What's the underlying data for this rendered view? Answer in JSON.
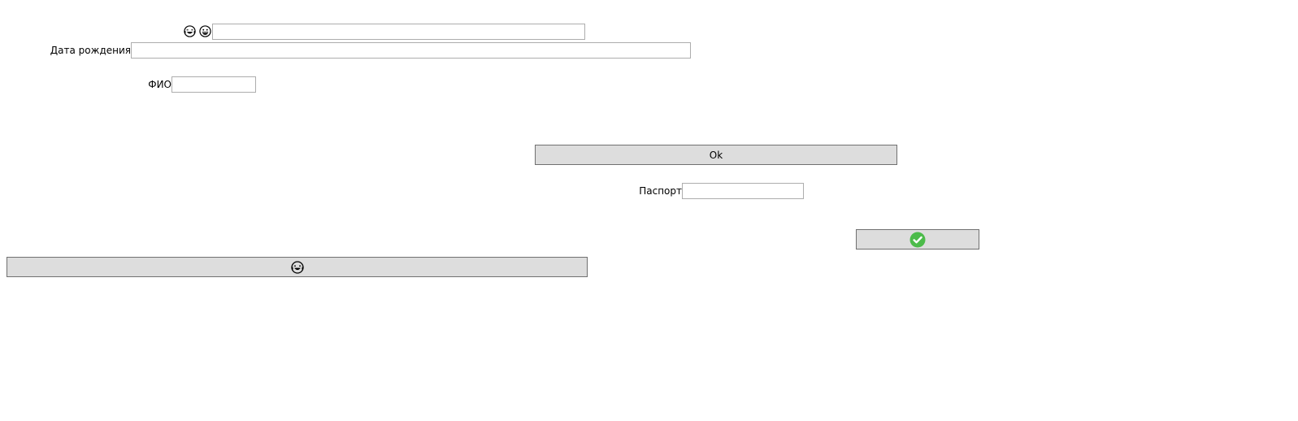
{
  "form": {
    "top_icons": [
      "laughing-face-icon",
      "grinning-face-icon"
    ],
    "top_field": {
      "value": "",
      "placeholder": ""
    },
    "birth_date": {
      "label": "Дата рождения",
      "value": "",
      "placeholder": ""
    },
    "fio": {
      "label": "ФИО",
      "value": "",
      "placeholder": ""
    },
    "passport": {
      "label": "Паспорт",
      "value": "",
      "placeholder": ""
    }
  },
  "buttons": {
    "ok": {
      "label": "Ok"
    },
    "confirm": {
      "icon": "check-circle-icon",
      "color": "#4cbb4a"
    },
    "emoji": {
      "icon": "laughing-face-icon"
    }
  },
  "colors": {
    "button_bg": "#dddddd",
    "button_border": "#707070",
    "field_border": "#adadad",
    "check_green": "#4cbb4a"
  }
}
